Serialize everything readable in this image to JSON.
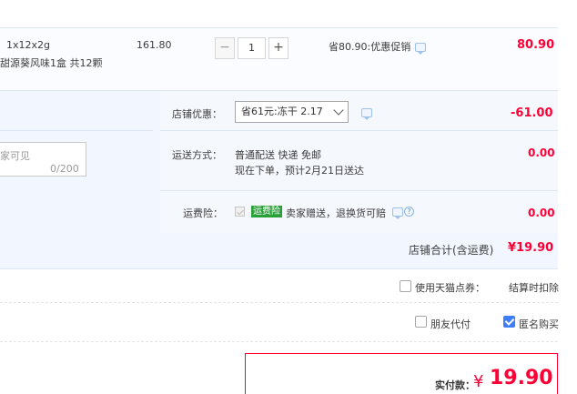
{
  "item": {
    "spec": "1x12x2g",
    "package": "甜源葵风味1盒 共12颗",
    "unit_price": "161.80",
    "quantity": "1",
    "minus": "−",
    "plus": "+",
    "promo": "省80.90:优惠促销",
    "total": "80.90"
  },
  "shop": {
    "discount_label": "店铺优惠：",
    "discount_select": "省61元:冻干 2.17",
    "discount_amount": "-61.00",
    "message_placeholder": "家可见",
    "message_count": "0/200",
    "shipping_label": "运送方式：",
    "shipping_method": "普通配送 快递 免邮",
    "shipping_eta": "现在下单，预计2月21日送达",
    "shipping_amount": "0.00",
    "insurance_label": "运费险：",
    "insurance_badge": "运费险",
    "insurance_text": "卖家赠送，退换货可赔",
    "insurance_amount": "0.00",
    "total_label": "店铺合计(含运费)",
    "total_value": "¥19.90"
  },
  "options": {
    "tmall_points": "使用天猫点券：",
    "settle_note": "结算时扣除",
    "friend_pay": "朋友代付",
    "anonymous": "匿名购买"
  },
  "payment": {
    "label": "实付款：",
    "currency": "¥",
    "amount": "19.90"
  },
  "colors": {
    "price_red": "#ff0036",
    "panel_blue": "#f2f7ff",
    "check_blue": "#3d7ef6"
  }
}
